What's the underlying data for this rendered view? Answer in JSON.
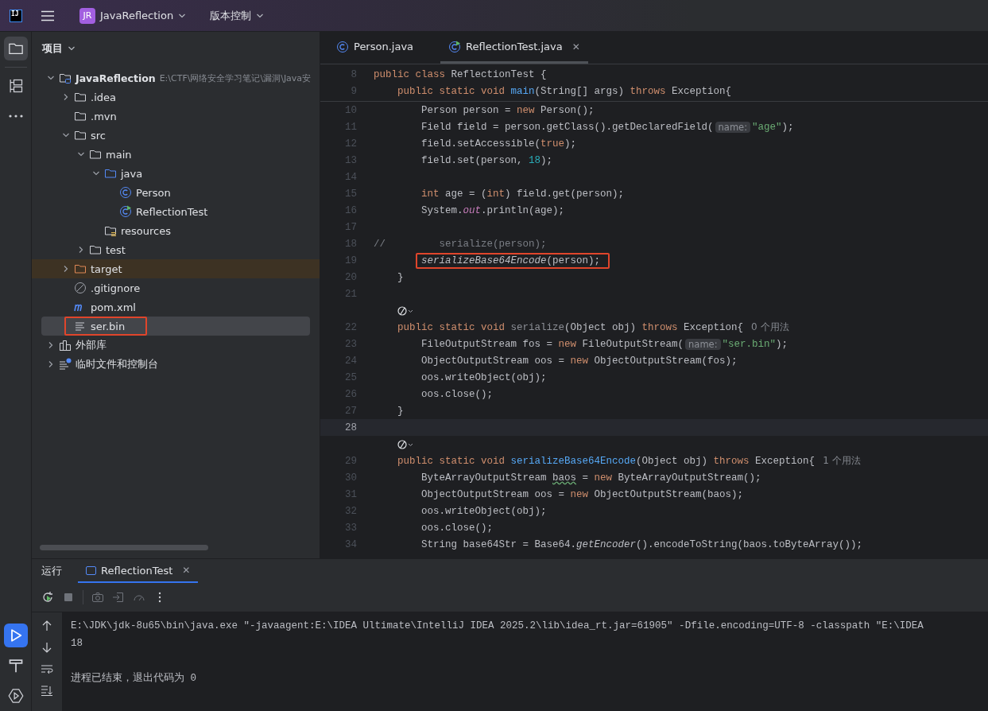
{
  "title_bar": {
    "logo_text": "IJ",
    "project_badge": "JR",
    "project_name": "JavaReflection",
    "vcs_label": "版本控制"
  },
  "left_toolbar": {
    "top": [
      {
        "kind": "project",
        "selected": true
      },
      {
        "kind": "structure",
        "selected": false
      },
      {
        "kind": "more",
        "selected": false
      }
    ],
    "bottom": [
      {
        "kind": "run",
        "selected": true
      },
      {
        "kind": "build",
        "selected": false
      },
      {
        "kind": "services",
        "selected": false
      }
    ]
  },
  "project_panel": {
    "title": "项目",
    "tree": [
      {
        "label": "JavaReflection",
        "path": "E:\\CTF\\网络安全学习笔记\\漏洞\\Java安",
        "kind": "project",
        "expanded": true,
        "selected": false,
        "boxed": false,
        "children": [
          {
            "label": ".idea",
            "kind": "folder",
            "expanded": false,
            "selected": false,
            "boxed": false
          },
          {
            "label": ".mvn",
            "kind": "folder",
            "selected": false,
            "boxed": false
          },
          {
            "label": "src",
            "kind": "folder",
            "expanded": true,
            "selected": false,
            "boxed": false,
            "children": [
              {
                "label": "main",
                "kind": "folder",
                "expanded": true,
                "selected": false,
                "boxed": false,
                "children": [
                  {
                    "label": "java",
                    "kind": "source-folder",
                    "expanded": true,
                    "selected": false,
                    "boxed": false,
                    "children": [
                      {
                        "label": "Person",
                        "kind": "class",
                        "selected": false,
                        "boxed": false
                      },
                      {
                        "label": "ReflectionTest",
                        "kind": "run-class",
                        "selected": false,
                        "boxed": false
                      }
                    ]
                  },
                  {
                    "label": "resources",
                    "kind": "resources-folder",
                    "selected": false,
                    "boxed": false
                  }
                ]
              },
              {
                "label": "test",
                "kind": "folder",
                "expanded": false,
                "selected": false,
                "boxed": false
              }
            ]
          },
          {
            "label": "target",
            "kind": "excluded-folder",
            "expanded": false,
            "selected": false,
            "boxed": false
          },
          {
            "label": ".gitignore",
            "kind": "ignore",
            "selected": false,
            "boxed": false
          },
          {
            "label": "pom.xml",
            "kind": "maven",
            "selected": false,
            "boxed": false
          },
          {
            "label": "ser.bin",
            "kind": "text",
            "selected": true,
            "boxed": true
          }
        ]
      },
      {
        "label": "外部库",
        "kind": "library",
        "expanded": false,
        "selected": false,
        "boxed": false
      },
      {
        "label": "临时文件和控制台",
        "kind": "scratch",
        "expanded": false,
        "selected": false,
        "boxed": false
      }
    ]
  },
  "editor": {
    "tabs": [
      {
        "label": "Person.java",
        "kind": "class",
        "selected": false
      },
      {
        "label": "ReflectionTest.java",
        "kind": "run-class",
        "selected": true,
        "close": "✕"
      }
    ],
    "lines": [
      {
        "kind": "code",
        "number": "8",
        "current": false,
        "boxed": false,
        "tokens": [
          {
            "kind": "keyword",
            "text": "public class "
          },
          {
            "kind": "plain",
            "text": "ReflectionTest {"
          }
        ],
        "children": [
          {
            "kind": "code",
            "number": "9",
            "current": false,
            "boxed": false,
            "tokens": [
              {
                "kind": "keyword",
                "text": "public static void "
              },
              {
                "kind": "declaration",
                "text": "main"
              },
              {
                "kind": "plain",
                "text": "(String[] args) "
              },
              {
                "kind": "keyword",
                "text": "throws "
              },
              {
                "kind": "plain",
                "text": "Exception{"
              }
            ],
            "children": [
              {
                "kind": "code",
                "number": "10",
                "current": false,
                "boxed": false,
                "tokens": [
                  {
                    "kind": "plain",
                    "text": "Person person = "
                  },
                  {
                    "kind": "keyword",
                    "text": "new "
                  },
                  {
                    "kind": "plain",
                    "text": "Person();"
                  }
                ]
              },
              {
                "kind": "code",
                "number": "11",
                "current": false,
                "boxed": false,
                "tokens": [
                  {
                    "kind": "plain",
                    "text": "Field field = person.getClass().getDeclaredField("
                  },
                  {
                    "kind": "hint",
                    "text": "name:"
                  },
                  {
                    "kind": "string",
                    "text": "\"age\""
                  },
                  {
                    "kind": "plain",
                    "text": ");"
                  }
                ]
              },
              {
                "kind": "code",
                "number": "12",
                "current": false,
                "boxed": false,
                "tokens": [
                  {
                    "kind": "plain",
                    "text": "field.setAccessible("
                  },
                  {
                    "kind": "keyword",
                    "text": "true"
                  },
                  {
                    "kind": "plain",
                    "text": ");"
                  }
                ]
              },
              {
                "kind": "code",
                "number": "13",
                "current": false,
                "boxed": false,
                "tokens": [
                  {
                    "kind": "plain",
                    "text": "field.set(person, "
                  },
                  {
                    "kind": "number",
                    "text": "18"
                  },
                  {
                    "kind": "plain",
                    "text": ");"
                  }
                ]
              },
              {
                "kind": "code",
                "number": "14",
                "current": false,
                "boxed": false
              },
              {
                "kind": "code",
                "number": "15",
                "current": false,
                "boxed": false,
                "tokens": [
                  {
                    "kind": "keyword",
                    "text": "int "
                  },
                  {
                    "kind": "plain",
                    "text": "age = ("
                  },
                  {
                    "kind": "keyword",
                    "text": "int"
                  },
                  {
                    "kind": "plain",
                    "text": ") field.get(person);"
                  }
                ]
              },
              {
                "kind": "code",
                "number": "16",
                "current": false,
                "boxed": false,
                "tokens": [
                  {
                    "kind": "plain",
                    "text": "System."
                  },
                  {
                    "kind": "field",
                    "text": "out"
                  },
                  {
                    "kind": "plain",
                    "text": ".println(age);"
                  }
                ]
              },
              {
                "kind": "code",
                "number": "17",
                "current": false,
                "boxed": false
              },
              {
                "kind": "comment",
                "number": "18",
                "current": false,
                "boxed": false,
                "tokens": [
                  {
                    "kind": "comment",
                    "text": "//         serialize(person);"
                  }
                ]
              },
              {
                "kind": "code",
                "number": "19",
                "current": false,
                "boxed": true,
                "tokens": [
                  {
                    "kind": "call",
                    "text": "serializeBase64Encode"
                  },
                  {
                    "kind": "plain",
                    "text": "(person);"
                  }
                ]
              }
            ]
          },
          {
            "kind": "code",
            "number": "20",
            "current": false,
            "boxed": false,
            "tokens": [
              {
                "kind": "plain",
                "text": "}"
              }
            ]
          },
          {
            "kind": "code",
            "number": "21",
            "current": false,
            "boxed": false
          },
          {
            "kind": "vision"
          },
          {
            "kind": "code",
            "number": "22",
            "current": false,
            "boxed": false,
            "tokens": [
              {
                "kind": "keyword",
                "text": "public static void "
              },
              {
                "kind": "unused",
                "text": "serialize"
              },
              {
                "kind": "plain",
                "text": "(Object obj) "
              },
              {
                "kind": "keyword",
                "text": "throws "
              },
              {
                "kind": "plain",
                "text": "Exception{"
              },
              {
                "kind": "usage",
                "text": "0 个用法"
              }
            ],
            "children": [
              {
                "kind": "code",
                "number": "23",
                "current": false,
                "boxed": false,
                "tokens": [
                  {
                    "kind": "plain",
                    "text": "FileOutputStream fos = "
                  },
                  {
                    "kind": "keyword",
                    "text": "new "
                  },
                  {
                    "kind": "plain",
                    "text": "FileOutputStream("
                  },
                  {
                    "kind": "hint",
                    "text": "name:"
                  },
                  {
                    "kind": "string",
                    "text": "\"ser.bin\""
                  },
                  {
                    "kind": "plain",
                    "text": ");"
                  }
                ]
              },
              {
                "kind": "code",
                "number": "24",
                "current": false,
                "boxed": false,
                "tokens": [
                  {
                    "kind": "plain",
                    "text": "ObjectOutputStream oos = "
                  },
                  {
                    "kind": "keyword",
                    "text": "new "
                  },
                  {
                    "kind": "plain",
                    "text": "ObjectOutputStream(fos);"
                  }
                ]
              },
              {
                "kind": "code",
                "number": "25",
                "current": false,
                "boxed": false,
                "tokens": [
                  {
                    "kind": "plain",
                    "text": "oos.writeObject(obj);"
                  }
                ]
              },
              {
                "kind": "code",
                "number": "26",
                "current": false,
                "boxed": false,
                "tokens": [
                  {
                    "kind": "plain",
                    "text": "oos.close();"
                  }
                ]
              }
            ]
          },
          {
            "kind": "code",
            "number": "27",
            "current": false,
            "boxed": false,
            "tokens": [
              {
                "kind": "plain",
                "text": "}"
              }
            ]
          },
          {
            "kind": "code",
            "number": "28",
            "current": true,
            "boxed": false
          },
          {
            "kind": "vision"
          },
          {
            "kind": "code",
            "number": "29",
            "current": false,
            "boxed": false,
            "tokens": [
              {
                "kind": "keyword",
                "text": "public static void "
              },
              {
                "kind": "declaration",
                "text": "serializeBase64Encode"
              },
              {
                "kind": "plain",
                "text": "(Object obj) "
              },
              {
                "kind": "keyword",
                "text": "throws "
              },
              {
                "kind": "plain",
                "text": "Exception{"
              },
              {
                "kind": "usage",
                "text": "1 个用法"
              }
            ],
            "children": [
              {
                "kind": "code",
                "number": "30",
                "current": false,
                "boxed": false,
                "tokens": [
                  {
                    "kind": "plain",
                    "text": "ByteArrayOutputStream "
                  },
                  {
                    "kind": "warned",
                    "text": "baos"
                  },
                  {
                    "kind": "plain",
                    "text": " = "
                  },
                  {
                    "kind": "keyword",
                    "text": "new "
                  },
                  {
                    "kind": "plain",
                    "text": "ByteArrayOutputStream();"
                  }
                ]
              },
              {
                "kind": "code",
                "number": "31",
                "current": false,
                "boxed": false,
                "tokens": [
                  {
                    "kind": "plain",
                    "text": "ObjectOutputStream oos = "
                  },
                  {
                    "kind": "keyword",
                    "text": "new "
                  },
                  {
                    "kind": "plain",
                    "text": "ObjectOutputStream(baos);"
                  }
                ]
              },
              {
                "kind": "code",
                "number": "32",
                "current": false,
                "boxed": false,
                "tokens": [
                  {
                    "kind": "plain",
                    "text": "oos.writeObject(obj);"
                  }
                ]
              },
              {
                "kind": "code",
                "number": "33",
                "current": false,
                "boxed": false,
                "tokens": [
                  {
                    "kind": "plain",
                    "text": "oos.close();"
                  }
                ]
              },
              {
                "kind": "code",
                "number": "34",
                "current": false,
                "boxed": false,
                "tokens": [
                  {
                    "kind": "plain",
                    "text": "String base64Str = Base64."
                  },
                  {
                    "kind": "call",
                    "text": "getEncoder"
                  },
                  {
                    "kind": "plain",
                    "text": "().encodeToString(baos.toByteArray());"
                  }
                ]
              }
            ]
          }
        ]
      }
    ]
  },
  "run_panel": {
    "title": "运行",
    "tabs": [
      {
        "label": "ReflectionTest",
        "selected": true,
        "close": "✕"
      }
    ],
    "toolbar": [
      {
        "kind": "rerun",
        "disabled": false
      },
      {
        "kind": "stop",
        "disabled": true
      },
      {
        "kind": "camera",
        "disabled": true
      },
      {
        "kind": "exit",
        "disabled": true
      },
      {
        "kind": "gauge",
        "disabled": true
      },
      {
        "kind": "more",
        "disabled": false
      }
    ],
    "side_tools": [
      {
        "kind": "up"
      },
      {
        "kind": "down"
      },
      {
        "kind": "wrap"
      },
      {
        "kind": "scroll-end"
      }
    ],
    "console": [
      {
        "kind": "command",
        "text": "E:\\JDK\\jdk-8u65\\bin\\java.exe \"-javaagent:E:\\IDEA Ultimate\\IntelliJ IDEA 2025.2\\lib\\idea_rt.jar=61905\" -Dfile.encoding=UTF-8 -classpath \"E:\\IDEA"
      },
      {
        "kind": "output",
        "text": "18"
      },
      {
        "kind": "status",
        "text": "进程已结束，退出代码为 0"
      }
    ]
  }
}
